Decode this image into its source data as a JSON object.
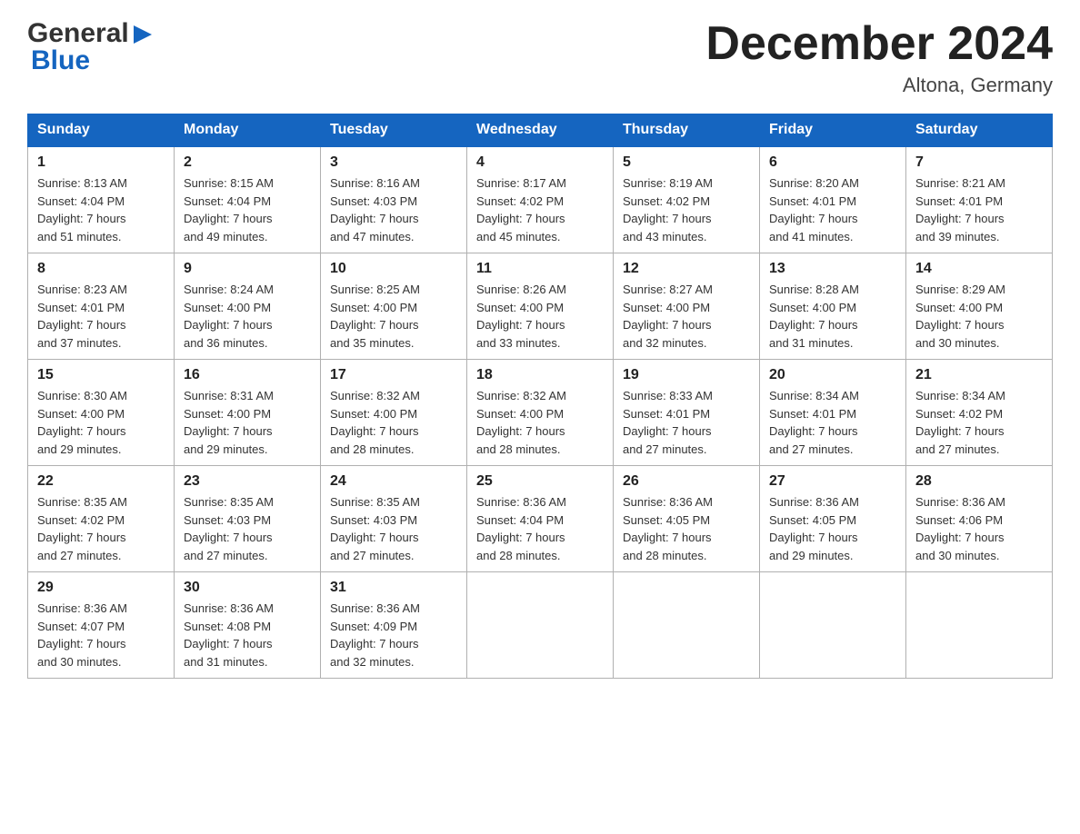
{
  "header": {
    "logo_general": "General",
    "logo_blue": "Blue",
    "month_title": "December 2024",
    "location": "Altona, Germany"
  },
  "weekdays": [
    "Sunday",
    "Monday",
    "Tuesday",
    "Wednesday",
    "Thursday",
    "Friday",
    "Saturday"
  ],
  "weeks": [
    [
      {
        "day": "1",
        "info": "Sunrise: 8:13 AM\nSunset: 4:04 PM\nDaylight: 7 hours\nand 51 minutes."
      },
      {
        "day": "2",
        "info": "Sunrise: 8:15 AM\nSunset: 4:04 PM\nDaylight: 7 hours\nand 49 minutes."
      },
      {
        "day": "3",
        "info": "Sunrise: 8:16 AM\nSunset: 4:03 PM\nDaylight: 7 hours\nand 47 minutes."
      },
      {
        "day": "4",
        "info": "Sunrise: 8:17 AM\nSunset: 4:02 PM\nDaylight: 7 hours\nand 45 minutes."
      },
      {
        "day": "5",
        "info": "Sunrise: 8:19 AM\nSunset: 4:02 PM\nDaylight: 7 hours\nand 43 minutes."
      },
      {
        "day": "6",
        "info": "Sunrise: 8:20 AM\nSunset: 4:01 PM\nDaylight: 7 hours\nand 41 minutes."
      },
      {
        "day": "7",
        "info": "Sunrise: 8:21 AM\nSunset: 4:01 PM\nDaylight: 7 hours\nand 39 minutes."
      }
    ],
    [
      {
        "day": "8",
        "info": "Sunrise: 8:23 AM\nSunset: 4:01 PM\nDaylight: 7 hours\nand 37 minutes."
      },
      {
        "day": "9",
        "info": "Sunrise: 8:24 AM\nSunset: 4:00 PM\nDaylight: 7 hours\nand 36 minutes."
      },
      {
        "day": "10",
        "info": "Sunrise: 8:25 AM\nSunset: 4:00 PM\nDaylight: 7 hours\nand 35 minutes."
      },
      {
        "day": "11",
        "info": "Sunrise: 8:26 AM\nSunset: 4:00 PM\nDaylight: 7 hours\nand 33 minutes."
      },
      {
        "day": "12",
        "info": "Sunrise: 8:27 AM\nSunset: 4:00 PM\nDaylight: 7 hours\nand 32 minutes."
      },
      {
        "day": "13",
        "info": "Sunrise: 8:28 AM\nSunset: 4:00 PM\nDaylight: 7 hours\nand 31 minutes."
      },
      {
        "day": "14",
        "info": "Sunrise: 8:29 AM\nSunset: 4:00 PM\nDaylight: 7 hours\nand 30 minutes."
      }
    ],
    [
      {
        "day": "15",
        "info": "Sunrise: 8:30 AM\nSunset: 4:00 PM\nDaylight: 7 hours\nand 29 minutes."
      },
      {
        "day": "16",
        "info": "Sunrise: 8:31 AM\nSunset: 4:00 PM\nDaylight: 7 hours\nand 29 minutes."
      },
      {
        "day": "17",
        "info": "Sunrise: 8:32 AM\nSunset: 4:00 PM\nDaylight: 7 hours\nand 28 minutes."
      },
      {
        "day": "18",
        "info": "Sunrise: 8:32 AM\nSunset: 4:00 PM\nDaylight: 7 hours\nand 28 minutes."
      },
      {
        "day": "19",
        "info": "Sunrise: 8:33 AM\nSunset: 4:01 PM\nDaylight: 7 hours\nand 27 minutes."
      },
      {
        "day": "20",
        "info": "Sunrise: 8:34 AM\nSunset: 4:01 PM\nDaylight: 7 hours\nand 27 minutes."
      },
      {
        "day": "21",
        "info": "Sunrise: 8:34 AM\nSunset: 4:02 PM\nDaylight: 7 hours\nand 27 minutes."
      }
    ],
    [
      {
        "day": "22",
        "info": "Sunrise: 8:35 AM\nSunset: 4:02 PM\nDaylight: 7 hours\nand 27 minutes."
      },
      {
        "day": "23",
        "info": "Sunrise: 8:35 AM\nSunset: 4:03 PM\nDaylight: 7 hours\nand 27 minutes."
      },
      {
        "day": "24",
        "info": "Sunrise: 8:35 AM\nSunset: 4:03 PM\nDaylight: 7 hours\nand 27 minutes."
      },
      {
        "day": "25",
        "info": "Sunrise: 8:36 AM\nSunset: 4:04 PM\nDaylight: 7 hours\nand 28 minutes."
      },
      {
        "day": "26",
        "info": "Sunrise: 8:36 AM\nSunset: 4:05 PM\nDaylight: 7 hours\nand 28 minutes."
      },
      {
        "day": "27",
        "info": "Sunrise: 8:36 AM\nSunset: 4:05 PM\nDaylight: 7 hours\nand 29 minutes."
      },
      {
        "day": "28",
        "info": "Sunrise: 8:36 AM\nSunset: 4:06 PM\nDaylight: 7 hours\nand 30 minutes."
      }
    ],
    [
      {
        "day": "29",
        "info": "Sunrise: 8:36 AM\nSunset: 4:07 PM\nDaylight: 7 hours\nand 30 minutes."
      },
      {
        "day": "30",
        "info": "Sunrise: 8:36 AM\nSunset: 4:08 PM\nDaylight: 7 hours\nand 31 minutes."
      },
      {
        "day": "31",
        "info": "Sunrise: 8:36 AM\nSunset: 4:09 PM\nDaylight: 7 hours\nand 32 minutes."
      },
      {
        "day": "",
        "info": ""
      },
      {
        "day": "",
        "info": ""
      },
      {
        "day": "",
        "info": ""
      },
      {
        "day": "",
        "info": ""
      }
    ]
  ]
}
